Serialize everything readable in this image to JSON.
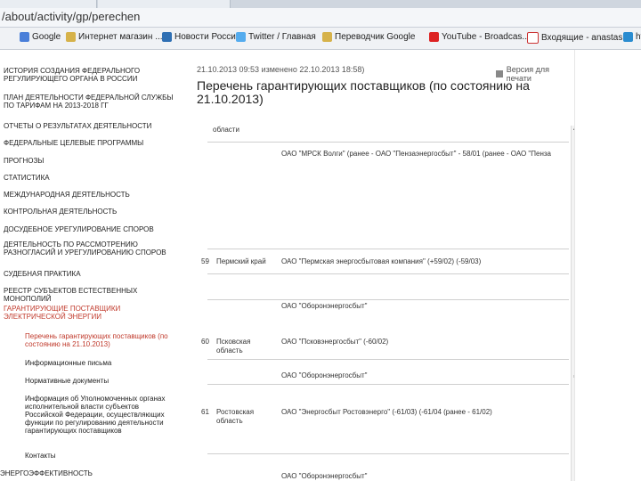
{
  "browser": {
    "url": "/about/activity/gp/perechen",
    "bookmarks": [
      {
        "label": "Google",
        "icon": "google-icon"
      },
      {
        "label": "Интернет магазин ...",
        "icon": "folder-icon"
      },
      {
        "label": "Новости России",
        "icon": "rambler-icon"
      },
      {
        "label": "Twitter / Главная",
        "icon": "twitter-icon"
      },
      {
        "label": "Переводчик Google",
        "icon": "folder-icon"
      },
      {
        "label": "YouTube - Broadcas...",
        "icon": "youtube-icon"
      },
      {
        "label": "Входящие - anastas...",
        "icon": "gmail-icon"
      },
      {
        "label": "http",
        "icon": "hp-icon"
      }
    ]
  },
  "sidebar": {
    "items": [
      {
        "label": "ИСТОРИЯ СОЗДАНИЯ ФЕДЕРАЛЬНОГО РЕГУЛИРУЮЩЕГО ОРГАНА В РОССИИ"
      },
      {
        "label": "ПЛАН ДЕЯТЕЛЬНОСТИ ФЕДЕРАЛЬНОЙ СЛУЖБЫ ПО ТАРИФАМ НА 2013-2018 ГГ"
      },
      {
        "label": "ОТЧЕТЫ О РЕЗУЛЬТАТАХ ДЕЯТЕЛЬНОСТИ"
      },
      {
        "label": "ФЕДЕРАЛЬНЫЕ ЦЕЛЕВЫЕ ПРОГРАММЫ"
      },
      {
        "label": "ПРОГНОЗЫ"
      },
      {
        "label": "СТАТИСТИКА"
      },
      {
        "label": "МЕЖДУНАРОДНАЯ ДЕЯТЕЛЬНОСТЬ"
      },
      {
        "label": "КОНТРОЛЬНАЯ ДЕЯТЕЛЬНОСТЬ"
      },
      {
        "label": "ДОСУДЕБНОЕ УРЕГУЛИРОВАНИЕ СПОРОВ"
      },
      {
        "label": "ДЕЯТЕЛЬНОСТЬ ПО РАССМОТРЕНИЮ РАЗНОГЛАСИЙ И УРЕГУЛИРОВАНИЮ СПОРОВ"
      },
      {
        "label": "СУДЕБНАЯ ПРАКТИКА"
      },
      {
        "label": "РЕЕСТР СУБЪЕКТОВ ЕСТЕСТВЕННЫХ МОНОПОЛИЙ"
      },
      {
        "label": "ГАРАНТИРУЮЩИЕ ПОСТАВЩИКИ ЭЛЕКТРИЧЕСКОЙ ЭНЕРГИИ"
      }
    ],
    "subitems": [
      {
        "label": "Перечень гарантирующих поставщиков (по состоянию на 21.10.2013)"
      },
      {
        "label": "Информационные письма"
      },
      {
        "label": "Нормативные документы"
      },
      {
        "label": "Информация об Уполномоченных органах исполнительной власти субъектов Российской Федерации, осуществляющих функции по регулированию деятельности гарантирующих поставщиков"
      },
      {
        "label": "Контакты"
      }
    ],
    "bottom_item": "ЭНЕРГОЭФФЕКТИВНОСТЬ"
  },
  "main": {
    "meta": "21.10.2013 09:53 изменено 22.10.2013 18:58)",
    "print_label": "Версия для печати",
    "title": "Перечень гарантирующих поставщиков (по состоянию на 21.10.2013)"
  },
  "table": {
    "rows": [
      {
        "num": "",
        "region": "области",
        "supplier": ""
      },
      {
        "num": "",
        "region": "",
        "supplier": "ОАО \"МРСК Волги\" (ранее - ОАО \"Пензаэнергосбыт\" - 58/01 (ранее - ОАО \"Пенза"
      },
      {
        "num": "59",
        "region": "Пермский край",
        "supplier": "ОАО \"Пермская энергосбытовая компания\" (+59/02) (-59/03)"
      },
      {
        "num": "",
        "region": "",
        "supplier": "ОАО \"Оборонэнергосбыт\""
      },
      {
        "num": "60",
        "region": "Псковская область",
        "supplier": "ОАО \"Псковэнергосбыт\" (-60/02)"
      },
      {
        "num": "",
        "region": "",
        "supplier": "ОАО \"Оборонэнергосбыт\""
      },
      {
        "num": "61",
        "region": "Ростовская область",
        "supplier": "ОАО \"Энергосбыт Ростовэнерго\" (-61/03) (-61/04 (ранее - 61/02)"
      },
      {
        "num": "",
        "region": "",
        "supplier": "ОАО \"Оборонэнергосбыт\""
      }
    ]
  }
}
